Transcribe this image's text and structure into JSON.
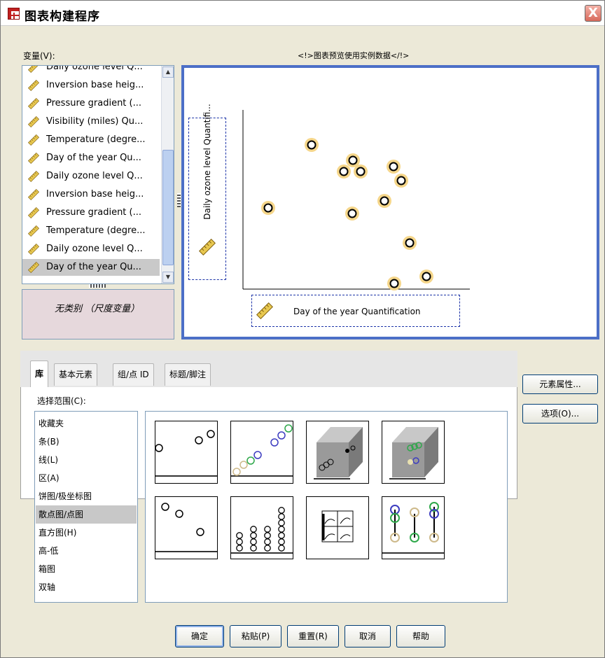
{
  "window": {
    "title": "图表构建程序",
    "close_glyph": "X"
  },
  "variables": {
    "label": "变量(V):",
    "items": [
      {
        "label": "Daily ozone level Q...",
        "icon": "ruler-icon"
      },
      {
        "label": "Inversion base heig...",
        "icon": "ruler-icon"
      },
      {
        "label": "Pressure gradient (...",
        "icon": "ruler-icon"
      },
      {
        "label": "Visibility (miles) Qu...",
        "icon": "ruler-icon"
      },
      {
        "label": "Temperature (degre...",
        "icon": "ruler-icon"
      },
      {
        "label": "Day of the year Qu...",
        "icon": "ruler-icon"
      },
      {
        "label": "Daily ozone level Q...",
        "icon": "ruler-icon"
      },
      {
        "label": "Inversion base heig...",
        "icon": "ruler-icon"
      },
      {
        "label": "Pressure gradient (...",
        "icon": "ruler-icon"
      },
      {
        "label": "Temperature (degre...",
        "icon": "ruler-icon"
      },
      {
        "label": "Daily ozone level Q...",
        "icon": "ruler-icon"
      },
      {
        "label": "Day of the year Qu...",
        "icon": "ruler-icon",
        "selected": true
      }
    ],
    "no_category": "无类别 （尺度变量）"
  },
  "preview": {
    "label": "<!>图表预览使用实例数据</!>",
    "y_drop": "Daily ozone level Quantifi...",
    "x_drop": "Day of the year Quantification",
    "marker_color": "#f5d68a"
  },
  "tabs": [
    {
      "label": "库",
      "active": true
    },
    {
      "label": "基本元素"
    },
    {
      "label": "组/点 ID"
    },
    {
      "label": "标题/脚注"
    }
  ],
  "gallery": {
    "range_label": "选择范围(C):",
    "types": [
      "收藏夹",
      "条(B)",
      "线(L)",
      "区(A)",
      "饼图/极坐标图",
      "散点图/点图",
      "直方图(H)",
      "高-低",
      "箱图",
      "双轴"
    ],
    "selected_type": "散点图/点图",
    "thumbnails": [
      "simple-scatter",
      "grouped-scatter",
      "3d-scatter",
      "3d-grouped-scatter",
      "summary-point",
      "dot-plot",
      "scatterplot-matrix",
      "drop-line"
    ]
  },
  "side_buttons": {
    "element_props": "元素属性...",
    "options": "选项(O)..."
  },
  "bottom_buttons": {
    "ok": "确定",
    "paste": "粘贴(P)",
    "reset": "重置(R)",
    "cancel": "取消",
    "help": "帮助"
  }
}
